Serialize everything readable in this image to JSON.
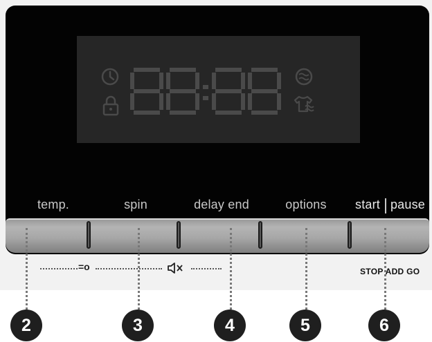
{
  "controls": {
    "buttons": [
      {
        "id": "temp",
        "label": "temp."
      },
      {
        "id": "spin",
        "label": "spin"
      },
      {
        "id": "delay-end",
        "label": "delay end"
      },
      {
        "id": "options",
        "label": "options"
      },
      {
        "id": "start-pause",
        "label_left": "start",
        "label_right": "pause"
      }
    ]
  },
  "display": {
    "digits": "88:88",
    "icons": [
      "clock-icon",
      "lock-icon",
      "water-wave-icon",
      "shirt-care-icon"
    ]
  },
  "legend": {
    "temp_symbol": "=o",
    "mute_symbol": "🔇",
    "stop_add_go": "STOP ADD GO"
  },
  "callouts": [
    "2",
    "3",
    "4",
    "5",
    "6"
  ],
  "colors": {
    "panel": "#030303",
    "display_bg": "#262626",
    "display_segments": "#4a4a4a",
    "bar": "#a7a7a7",
    "badge": "#1f1f1f"
  }
}
